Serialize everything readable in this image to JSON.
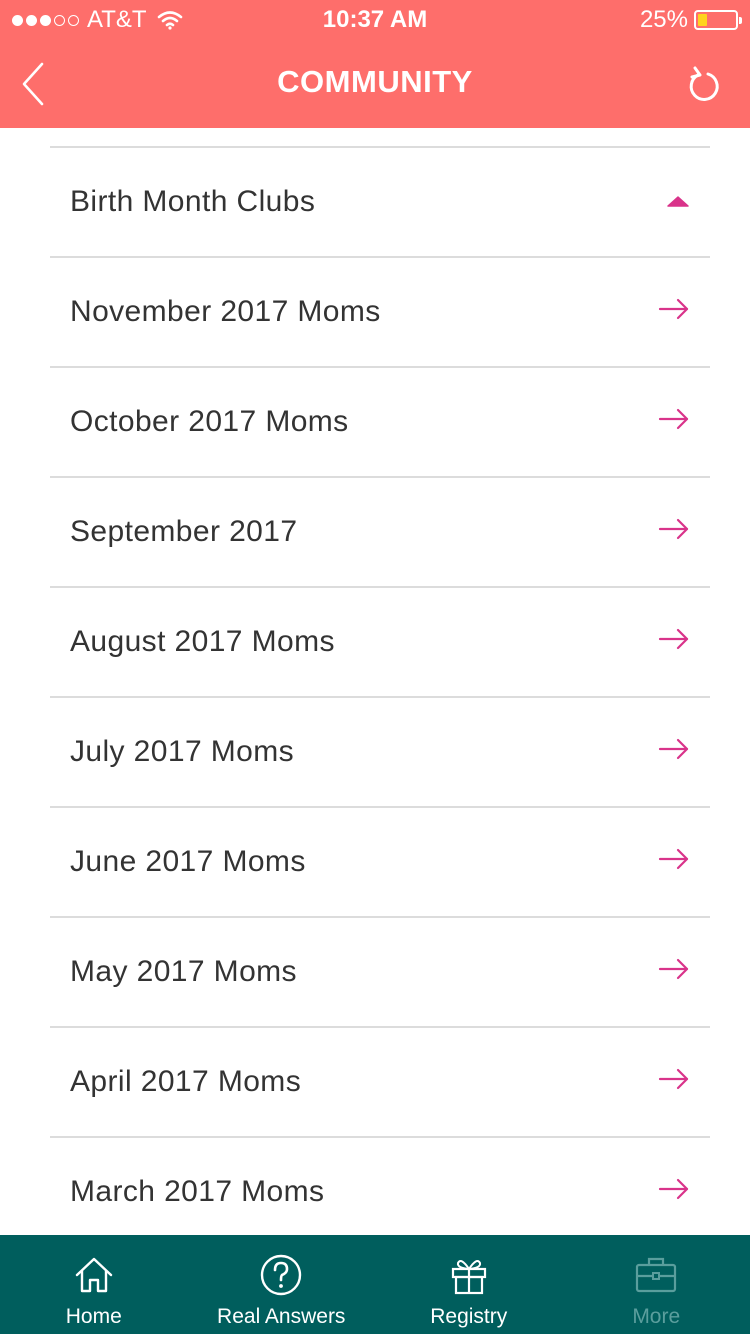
{
  "status_bar": {
    "carrier": "AT&T",
    "time": "10:37 AM",
    "battery": "25%",
    "battery_level": 0.25
  },
  "header": {
    "title": "COMMUNITY",
    "back_icon": "chevron-left-icon",
    "refresh_icon": "refresh-icon"
  },
  "colors": {
    "header_bg": "#fe6e6b",
    "accent": "#d9338a",
    "tabbar_bg": "#005e5d"
  },
  "list": {
    "section_header": "Birth Month Clubs",
    "items": [
      {
        "label": "November 2017 Moms"
      },
      {
        "label": "October 2017 Moms"
      },
      {
        "label": "September 2017"
      },
      {
        "label": "August 2017 Moms"
      },
      {
        "label": "July 2017 Moms"
      },
      {
        "label": "June 2017 Moms"
      },
      {
        "label": "May 2017 Moms"
      },
      {
        "label": "April 2017 Moms"
      },
      {
        "label": "March 2017 Moms"
      }
    ]
  },
  "tabbar": {
    "tabs": [
      {
        "label": "Home",
        "icon": "home-icon"
      },
      {
        "label": "Real Answers",
        "icon": "question-circle-icon"
      },
      {
        "label": "Registry",
        "icon": "gift-icon"
      },
      {
        "label": "More",
        "icon": "briefcase-icon"
      }
    ]
  }
}
